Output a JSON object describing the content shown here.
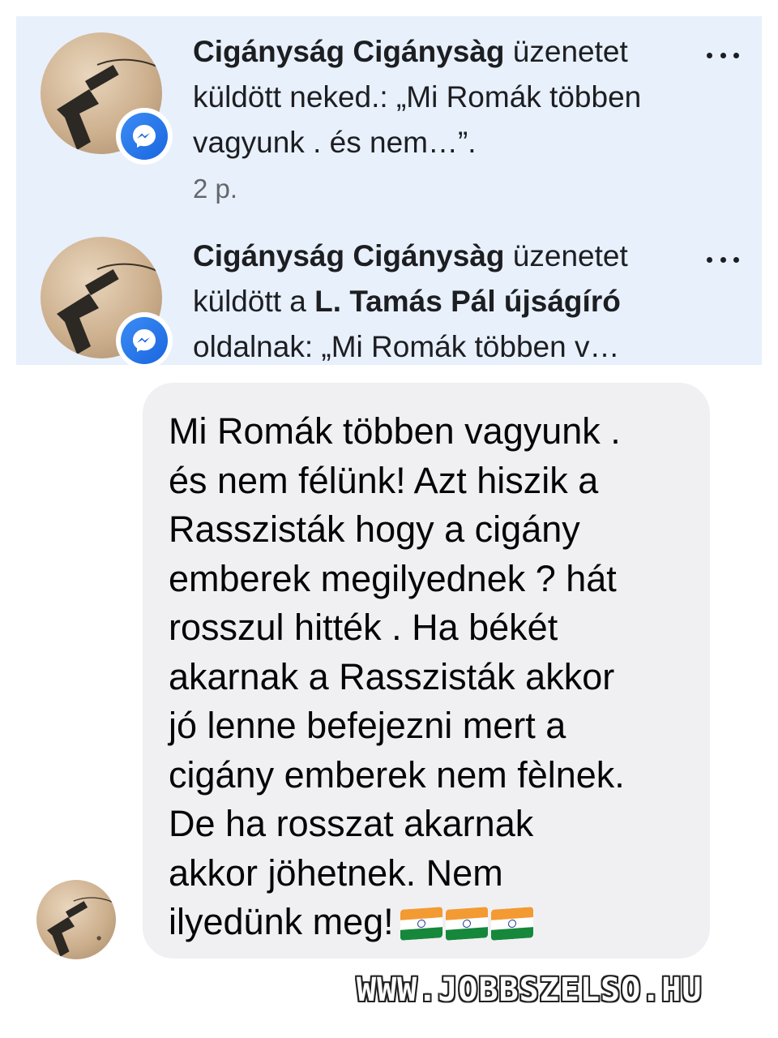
{
  "notifications": [
    {
      "sender": "Cigányság Cigánysàg",
      "text_after_sender": " üzenetet küldött neked.: „Mi Romák többen vagyunk . és nem…”.",
      "time": "2 p.",
      "more_label": "…",
      "badge_icon": "messenger-icon"
    },
    {
      "sender": "Cigányság Cigánysàg",
      "text_mid": " üzenetet küldött a ",
      "page_name": "L. Tamás Pál újságíró",
      "text_after_page": " oldalnak: „Mi Romák többen v…",
      "more_label": "…",
      "badge_icon": "messenger-icon"
    }
  ],
  "message": {
    "text": "Mi Romák többen vagyunk .\nés nem félünk! Azt hiszik a\nRasszisták hogy a cigány\nemberek megilyednek ?  hát\nrosszul hitték . Ha békét\nakarnak a Rasszisták akkor\njó lenne befejezni mert a\ncigány emberek nem fèlnek.\nDe ha rosszat akarnak\nakkor jöhetnek. Nem\nilyedünk meg!",
    "emoji": "india-flag-emoji",
    "emoji_count": 3
  },
  "watermark": "WWW.JOBBSZELSO.HU",
  "colors": {
    "notification_bg": "#e8f0fc",
    "bubble_bg": "#f0f0f3",
    "messenger_blue": "#1a66e0",
    "secondary_text": "#65676b"
  }
}
